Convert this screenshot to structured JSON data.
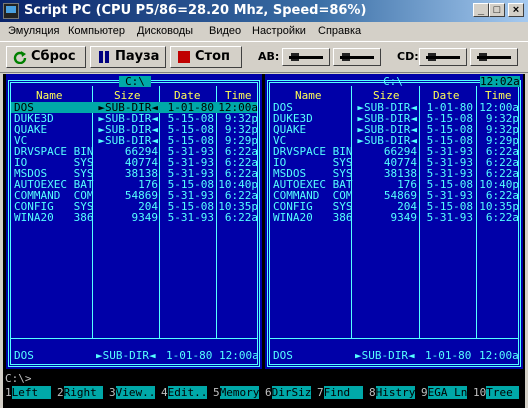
{
  "window": {
    "title": "Script PC (CPU P5/86=28.20 Mhz, Speed=86%)",
    "min_glyph": "_",
    "max_glyph": "□",
    "close_glyph": "×"
  },
  "menu": [
    "Эмуляция",
    "Компьютер",
    "Дисководы",
    "Видео",
    "Настройки",
    "Справка"
  ],
  "toolbar": {
    "reset_label": "Сброс",
    "pause_label": "Пауза",
    "stop_label": "Стоп",
    "ab_label": "AB:",
    "cd_label": "CD:",
    "reset_icon": "refresh-icon",
    "pause_icon": "pause-icon",
    "stop_icon": "stop-icon",
    "colors": {
      "reset": "#008000",
      "pause": "#000080",
      "stop": "#c00000"
    }
  },
  "dos": {
    "colors": {
      "panel_bg": "#0000a8",
      "text": "#55ffff",
      "header": "#ffff55",
      "highlight": "#00a8a8"
    },
    "left_panel": {
      "path": "C:\\",
      "columns": [
        "Name",
        "Size",
        "Date",
        "Time"
      ],
      "rows": [
        {
          "name": "DOS",
          "size": "►SUB-DIR◄",
          "date": "1-01-80",
          "time": "12:00a"
        },
        {
          "name": "DUKE3D",
          "size": "►SUB-DIR◄",
          "date": "5-15-08",
          "time": "9:32p"
        },
        {
          "name": "QUAKE",
          "size": "►SUB-DIR◄",
          "date": "5-15-08",
          "time": "9:32p"
        },
        {
          "name": "VC",
          "size": "►SUB-DIR◄",
          "date": "5-15-08",
          "time": "9:29p"
        },
        {
          "name": "DRVSPACE BIN",
          "size": "66294",
          "date": "5-31-93",
          "time": "6:22a"
        },
        {
          "name": "IO       SYS",
          "size": "40774",
          "date": "5-31-93",
          "time": "6:22a"
        },
        {
          "name": "MSDOS    SYS",
          "size": "38138",
          "date": "5-31-93",
          "time": "6:22a"
        },
        {
          "name": "AUTOEXEC BAT",
          "size": "176",
          "date": "5-15-08",
          "time": "10:40p"
        },
        {
          "name": "COMMAND  COM",
          "size": "54869",
          "date": "5-31-93",
          "time": "6:22a"
        },
        {
          "name": "CONFIG   SYS",
          "size": "204",
          "date": "5-15-08",
          "time": "10:35p"
        },
        {
          "name": "WINA20   386",
          "size": "9349",
          "date": "5-31-93",
          "time": "6:22a"
        }
      ],
      "selected_row": 0,
      "footer": {
        "name": "DOS",
        "size": "►SUB-DIR◄",
        "date": "1-01-80",
        "time": "12:00a"
      }
    },
    "right_panel": {
      "path": "C:\\",
      "clock": "12:02a",
      "columns": [
        "Name",
        "Size",
        "Date",
        "Time"
      ],
      "rows": [
        {
          "name": "DOS",
          "size": "►SUB-DIR◄",
          "date": "1-01-80",
          "time": "12:00a"
        },
        {
          "name": "DUKE3D",
          "size": "►SUB-DIR◄",
          "date": "5-15-08",
          "time": "9:32p"
        },
        {
          "name": "QUAKE",
          "size": "►SUB-DIR◄",
          "date": "5-15-08",
          "time": "9:32p"
        },
        {
          "name": "VC",
          "size": "►SUB-DIR◄",
          "date": "5-15-08",
          "time": "9:29p"
        },
        {
          "name": "DRVSPACE BIN",
          "size": "66294",
          "date": "5-31-93",
          "time": "6:22a"
        },
        {
          "name": "IO       SYS",
          "size": "40774",
          "date": "5-31-93",
          "time": "6:22a"
        },
        {
          "name": "MSDOS    SYS",
          "size": "38138",
          "date": "5-31-93",
          "time": "6:22a"
        },
        {
          "name": "AUTOEXEC BAT",
          "size": "176",
          "date": "5-15-08",
          "time": "10:40p"
        },
        {
          "name": "COMMAND  COM",
          "size": "54869",
          "date": "5-31-93",
          "time": "6:22a"
        },
        {
          "name": "CONFIG   SYS",
          "size": "204",
          "date": "5-15-08",
          "time": "10:35p"
        },
        {
          "name": "WINA20   386",
          "size": "9349",
          "date": "5-31-93",
          "time": "6:22a"
        }
      ],
      "footer": {
        "name": "DOS",
        "size": "►SUB-DIR◄",
        "date": "1-01-80",
        "time": "12:00a"
      }
    },
    "prompt": "C:\\>",
    "fkeys": [
      {
        "num": "1",
        "label": "Left  "
      },
      {
        "num": "2",
        "label": "Right "
      },
      {
        "num": "3",
        "label": "View.."
      },
      {
        "num": "4",
        "label": "Edit.."
      },
      {
        "num": "5",
        "label": "Memory"
      },
      {
        "num": "6",
        "label": "DirSiz"
      },
      {
        "num": "7",
        "label": "Find  "
      },
      {
        "num": "8",
        "label": "Histry"
      },
      {
        "num": "9",
        "label": "EGA Ln"
      },
      {
        "num": "10",
        "label": "Tree "
      }
    ]
  }
}
